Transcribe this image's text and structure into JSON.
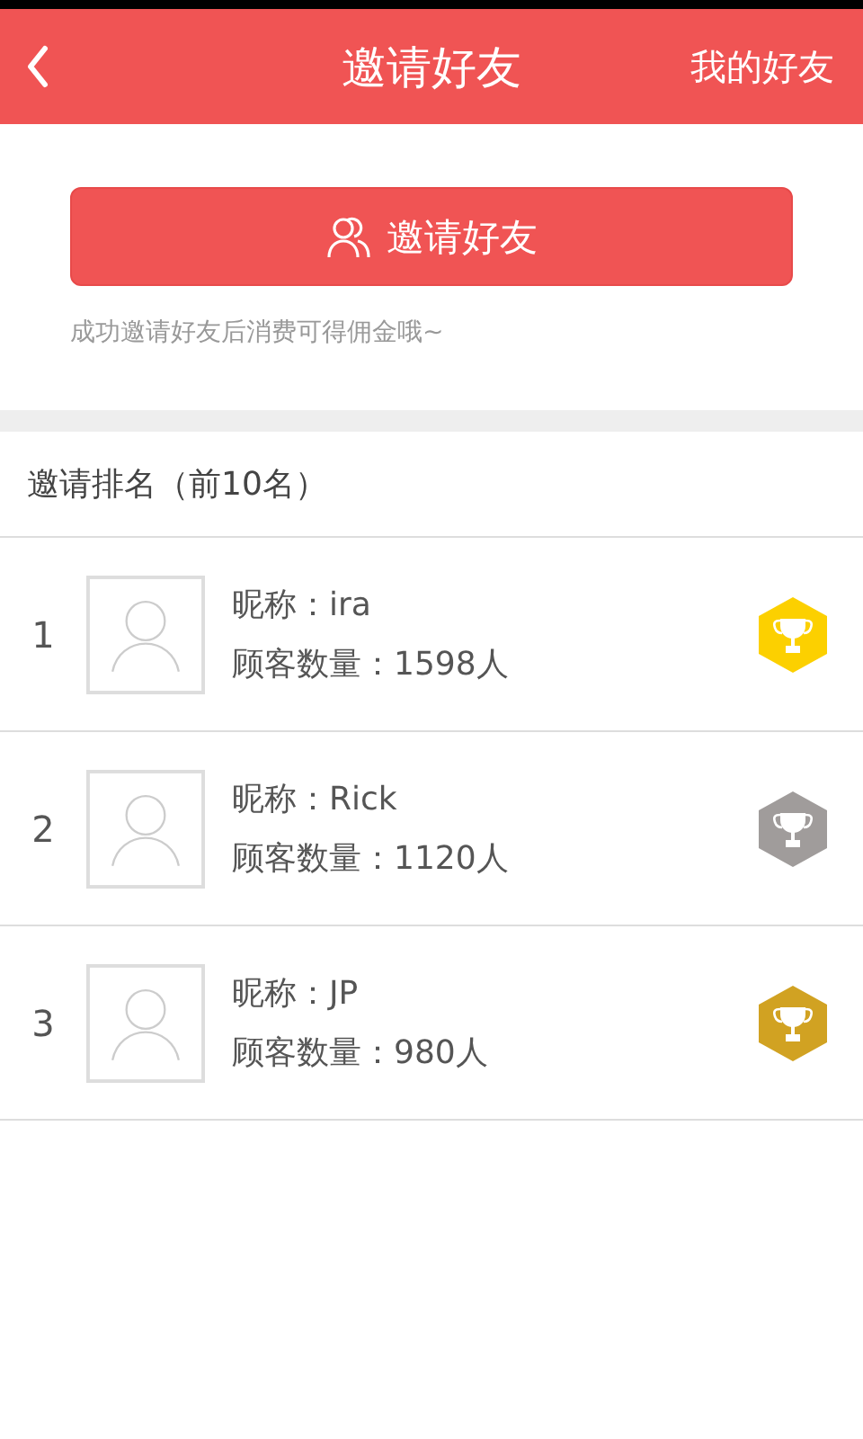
{
  "header": {
    "title": "邀请好友",
    "action": "我的好友"
  },
  "invite": {
    "button": "邀请好友",
    "hint": "成功邀请好友后消费可得佣金哦~"
  },
  "ranking": {
    "heading": "邀请排名（前10名）",
    "rows": [
      {
        "rank": "1",
        "nickname": "昵称：ira",
        "customers": "顾客数量：1598人",
        "color": "#fcd000"
      },
      {
        "rank": "2",
        "nickname": "昵称：Rick",
        "customers": "顾客数量：1120人",
        "color": "#a09c9b"
      },
      {
        "rank": "3",
        "nickname": "昵称：JP",
        "customers": "顾客数量：980人",
        "color": "#d1a222"
      }
    ]
  }
}
